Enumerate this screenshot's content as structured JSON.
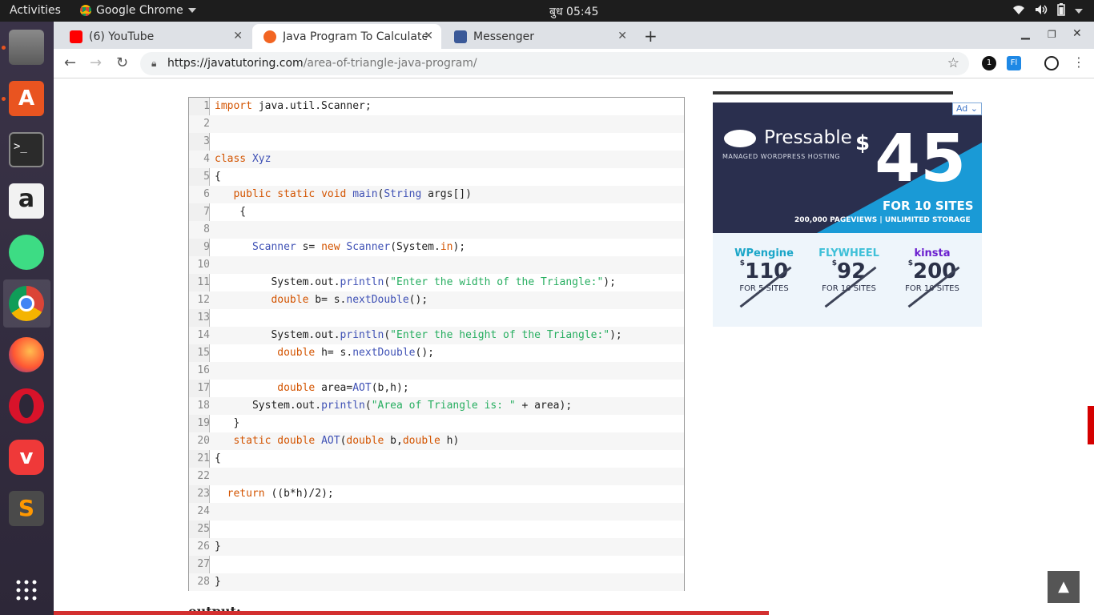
{
  "topbar": {
    "activities": "Activities",
    "app_name": "Google Chrome",
    "clock": "बुध 05:45"
  },
  "tabs": [
    {
      "label": "(6) YouTube"
    },
    {
      "label": "Java Program To Calculate"
    },
    {
      "label": "Messenger"
    }
  ],
  "toolbar": {
    "url_host": "https://javatutoring.com",
    "url_path": "/area-of-triangle-java-program/"
  },
  "code": {
    "lines": [
      "import java.util.Scanner;",
      "",
      "",
      "class Xyz",
      "{",
      "   public static void main(String args[])",
      "    {",
      "",
      "      Scanner s= new Scanner(System.in);",
      "",
      "         System.out.println(\"Enter the width of the Triangle:\");",
      "         double b= s.nextDouble();",
      "",
      "         System.out.println(\"Enter the height of the Triangle:\");",
      "          double h= s.nextDouble();",
      "",
      "          double area=AOT(b,h);",
      "      System.out.println(\"Area of Triangle is: \" + area);",
      "   }",
      "   static double AOT(double b,double h)",
      "{",
      "",
      "  return ((b*h)/2);",
      "",
      "",
      "}",
      "",
      "}"
    ]
  },
  "output_label": "output:",
  "ad": {
    "badge": "Ad",
    "brand": "Pressable",
    "tagline": "MANAGED WORDPRESS HOSTING",
    "currency": "$",
    "price": "45",
    "for_sites": "FOR 10 SITES",
    "details": "200,000 PAGEVIEWS  |  UNLIMITED STORAGE",
    "competitors": [
      {
        "name": "WPengine",
        "price": "110",
        "sites": "FOR 5 SITES",
        "color": "#1ba6c8"
      },
      {
        "name": "FLYWHEEL",
        "price": "92",
        "sites": "FOR 10 SITES",
        "color": "#3fc0d8"
      },
      {
        "name": "kinsta",
        "price": "200",
        "sites": "FOR 10 SITES",
        "color": "#6a1ecf"
      }
    ]
  }
}
